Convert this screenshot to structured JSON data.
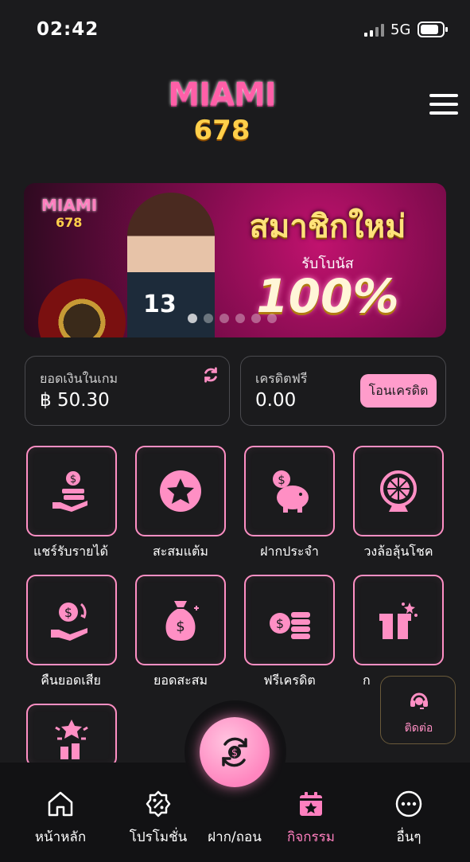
{
  "status_bar": {
    "time": "02:42",
    "network": "5G"
  },
  "header": {
    "logo_text": "MIAMI",
    "logo_sub": "678"
  },
  "banner": {
    "logo_text": "MIAMI",
    "logo_sub": "678",
    "headline": "สมาชิกใหม่",
    "subline": "รับโบนัส",
    "bonus": "100%",
    "jersey_number": "13",
    "slide_count": 6,
    "active_slide": 1
  },
  "balance": {
    "label": "ยอดเงินในเกม",
    "value": "฿ 50.30"
  },
  "credit": {
    "label": "เครดิตฟรี",
    "value": "0.00",
    "button_label": "โอนเครดิต"
  },
  "menu": {
    "items": [
      {
        "label": "แชร์รับรายได้",
        "icon": "share-income-icon"
      },
      {
        "label": "สะสมแต้ม",
        "icon": "star-points-icon"
      },
      {
        "label": "ฝากประจำ",
        "icon": "piggy-bank-icon"
      },
      {
        "label": "วงล้อลุ้นโชค",
        "icon": "lucky-wheel-icon"
      },
      {
        "label": "คืนยอดเสีย",
        "icon": "cashback-icon"
      },
      {
        "label": "ยอดสะสม",
        "icon": "money-bag-icon"
      },
      {
        "label": "ฟรีเครดิต",
        "icon": "coins-icon"
      },
      {
        "label": "ก",
        "icon": "gift-box-icon"
      },
      {
        "label": "",
        "icon": "reward-icon"
      }
    ]
  },
  "contact": {
    "label": "ติดต่อ"
  },
  "bottom_nav": {
    "items": [
      {
        "label": "หน้าหลัก",
        "icon": "home-icon"
      },
      {
        "label": "โปรโมชั่น",
        "icon": "promotion-icon"
      },
      {
        "label": "ฝาก/ถอน",
        "icon": "deposit-withdraw-icon"
      },
      {
        "label": "กิจกรรม",
        "icon": "calendar-star-icon"
      },
      {
        "label": "อื่นๆ",
        "icon": "more-icon"
      }
    ],
    "active": "กิจกรรม"
  },
  "colors": {
    "accent": "#ff8fc4",
    "background": "#1b1b1d",
    "nav_background": "#121214"
  }
}
